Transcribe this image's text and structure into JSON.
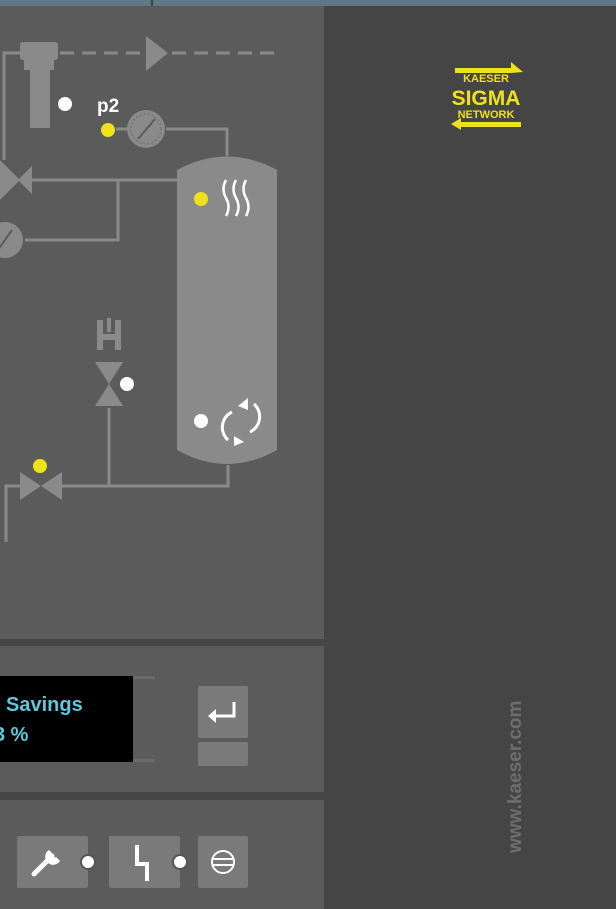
{
  "schematic": {
    "pressure_label": "p2"
  },
  "display": {
    "line1": "Savings",
    "line2": "3 %"
  },
  "brand": {
    "logo_top": "KAESER",
    "logo_mid": "SIGMA",
    "logo_bottom": "NETWORK",
    "website": "www.kaeser.com"
  },
  "icons": {
    "enter": "enter-return-icon",
    "service": "wrench-icon",
    "fault": "lightning-fault-icon",
    "load": "load-idle-icon",
    "heater": "heater-waves-icon",
    "refresh": "circulation-arrows-icon",
    "gauge": "pressure-gauge-icon",
    "valve": "valve-icon",
    "filter": "filter-icon"
  },
  "colors": {
    "accent_yellow": "#f0e21a",
    "lcd_text": "#5ec8dc",
    "panel": "#5b5b5b",
    "background": "#454545",
    "line_gray": "#8a8a8a",
    "top_strip": "#5e7888"
  }
}
